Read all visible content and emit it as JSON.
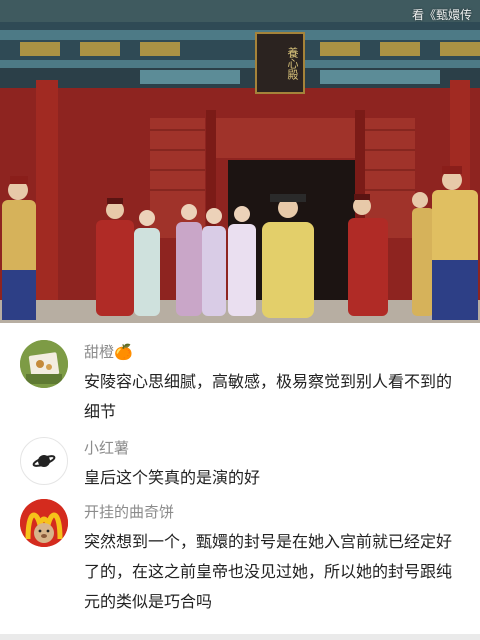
{
  "video": {
    "watermark": "看《甄嬛传",
    "plaque_text": "養心殿"
  },
  "comments": [
    {
      "username": "甜橙",
      "username_emoji": "🍊",
      "text": "安陵容心思细腻，高敏感，极易察觉到别人看不到的细节",
      "avatar_icon": "food-photo-avatar"
    },
    {
      "username": "小红薯",
      "text": "皇后这个笑真的是演的好",
      "avatar_icon": "planet-icon"
    },
    {
      "username": "开挂的曲奇饼",
      "text": "突然想到一个，甄嬛的封号是在她入宫前就已经定好了的，在这之前皇帝也没见过她，所以她的封号跟纯元的类似是巧合吗",
      "avatar_icon": "mcdonalds-bear-avatar"
    }
  ]
}
